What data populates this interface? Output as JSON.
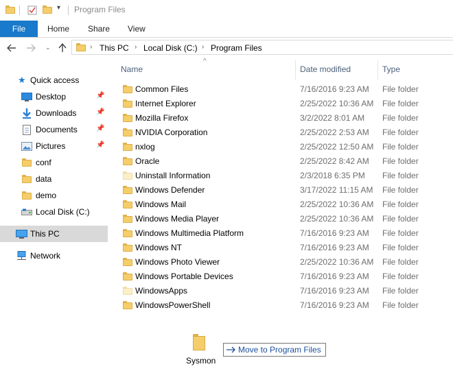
{
  "window": {
    "title": "Program Files"
  },
  "ribbon": {
    "tabs": [
      "File",
      "Home",
      "Share",
      "View"
    ]
  },
  "address": {
    "crumbs": [
      "This PC",
      "Local Disk (C:)",
      "Program Files"
    ]
  },
  "nav": {
    "quick_access": "Quick access",
    "items": [
      {
        "label": "Desktop",
        "icon": "desktop-icon",
        "pinned": true
      },
      {
        "label": "Downloads",
        "icon": "download-icon",
        "pinned": true
      },
      {
        "label": "Documents",
        "icon": "documents-icon",
        "pinned": true
      },
      {
        "label": "Pictures",
        "icon": "pictures-icon",
        "pinned": true
      },
      {
        "label": "conf",
        "icon": "folder-icon",
        "pinned": false
      },
      {
        "label": "data",
        "icon": "folder-icon",
        "pinned": false
      },
      {
        "label": "demo",
        "icon": "folder-icon",
        "pinned": false
      },
      {
        "label": "Local Disk (C:)",
        "icon": "drive-icon",
        "pinned": false
      }
    ],
    "this_pc": "This PC",
    "network": "Network"
  },
  "columns": {
    "name": "Name",
    "date": "Date modified",
    "type": "Type"
  },
  "files": [
    {
      "name": "Common Files",
      "date": "7/16/2016 9:23 AM",
      "type": "File folder",
      "pale": false
    },
    {
      "name": "Internet Explorer",
      "date": "2/25/2022 10:36 AM",
      "type": "File folder",
      "pale": false
    },
    {
      "name": "Mozilla Firefox",
      "date": "3/2/2022 8:01 AM",
      "type": "File folder",
      "pale": false
    },
    {
      "name": "NVIDIA Corporation",
      "date": "2/25/2022 2:53 AM",
      "type": "File folder",
      "pale": false
    },
    {
      "name": "nxlog",
      "date": "2/25/2022 12:50 AM",
      "type": "File folder",
      "pale": false
    },
    {
      "name": "Oracle",
      "date": "2/25/2022 8:42 AM",
      "type": "File folder",
      "pale": false
    },
    {
      "name": "Uninstall Information",
      "date": "2/3/2018 6:35 PM",
      "type": "File folder",
      "pale": true
    },
    {
      "name": "Windows Defender",
      "date": "3/17/2022 11:15 AM",
      "type": "File folder",
      "pale": false
    },
    {
      "name": "Windows Mail",
      "date": "2/25/2022 10:36 AM",
      "type": "File folder",
      "pale": false
    },
    {
      "name": "Windows Media Player",
      "date": "2/25/2022 10:36 AM",
      "type": "File folder",
      "pale": false
    },
    {
      "name": "Windows Multimedia Platform",
      "date": "7/16/2016 9:23 AM",
      "type": "File folder",
      "pale": false
    },
    {
      "name": "Windows NT",
      "date": "7/16/2016 9:23 AM",
      "type": "File folder",
      "pale": false
    },
    {
      "name": "Windows Photo Viewer",
      "date": "2/25/2022 10:36 AM",
      "type": "File folder",
      "pale": false
    },
    {
      "name": "Windows Portable Devices",
      "date": "7/16/2016 9:23 AM",
      "type": "File folder",
      "pale": false
    },
    {
      "name": "WindowsApps",
      "date": "7/16/2016 9:23 AM",
      "type": "File folder",
      "pale": true
    },
    {
      "name": "WindowsPowerShell",
      "date": "7/16/2016 9:23 AM",
      "type": "File folder",
      "pale": false
    }
  ],
  "drag": {
    "item": "Sysmon",
    "tooltip": "Move to Program Files"
  },
  "colors": {
    "accent": "#1979ca",
    "selected": "#d9d9d9"
  }
}
